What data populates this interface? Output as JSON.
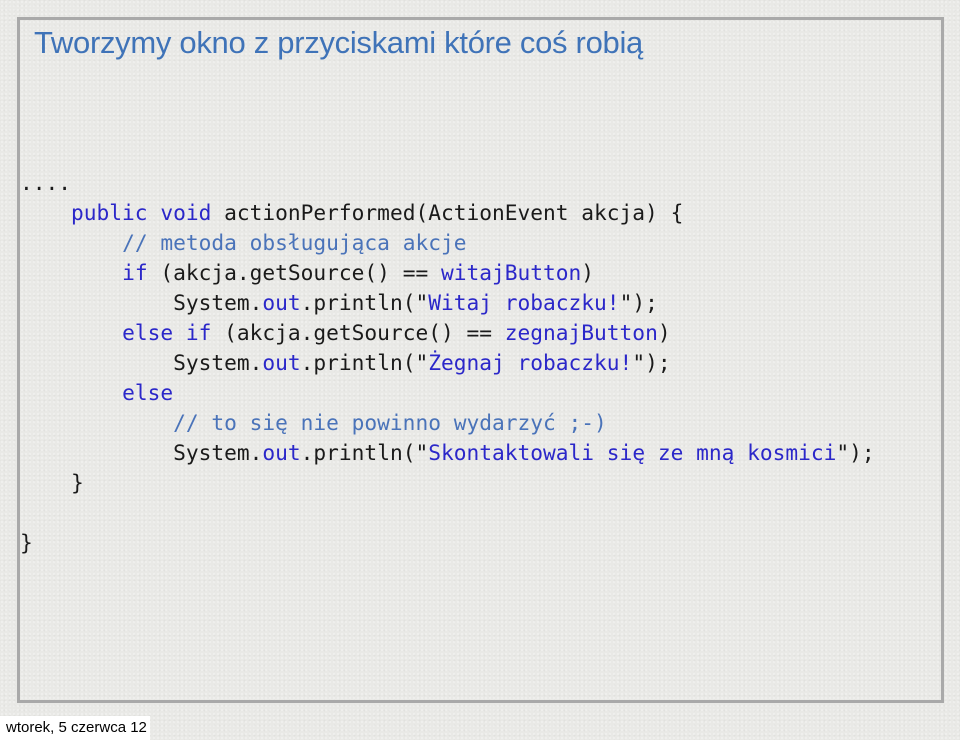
{
  "slide": {
    "title": "Tworzymy okno z przyciskami które coś robią",
    "title_color": "#3f73b8",
    "border_color": "#a9a9a9"
  },
  "code_colors": {
    "plain": "#1a1a1a",
    "keyword": "#2b27c9",
    "comment": "#4a73b9",
    "string": "#2b27c9"
  },
  "code_lines": [
    [
      {
        "t": "....",
        "k": "plain"
      }
    ],
    [
      {
        "t": "    ",
        "k": "plain"
      },
      {
        "t": "public void",
        "k": "keyword"
      },
      {
        "t": " actionPerformed(ActionEvent akcja) {",
        "k": "plain"
      }
    ],
    [
      {
        "t": "        ",
        "k": "plain"
      },
      {
        "t": "// metoda obsługująca akcje",
        "k": "comment"
      }
    ],
    [
      {
        "t": "        ",
        "k": "plain"
      },
      {
        "t": "if",
        "k": "keyword"
      },
      {
        "t": " (akcja.getSource() == ",
        "k": "plain"
      },
      {
        "t": "witajButton",
        "k": "keyword"
      },
      {
        "t": ")",
        "k": "plain"
      }
    ],
    [
      {
        "t": "            System.",
        "k": "plain"
      },
      {
        "t": "out",
        "k": "keyword"
      },
      {
        "t": ".println(\"",
        "k": "plain"
      },
      {
        "t": "Witaj robaczku!",
        "k": "string"
      },
      {
        "t": "\");",
        "k": "plain"
      }
    ],
    [
      {
        "t": "        ",
        "k": "plain"
      },
      {
        "t": "else if",
        "k": "keyword"
      },
      {
        "t": " (akcja.getSource() == ",
        "k": "plain"
      },
      {
        "t": "zegnajButton",
        "k": "keyword"
      },
      {
        "t": ")",
        "k": "plain"
      }
    ],
    [
      {
        "t": "            System.",
        "k": "plain"
      },
      {
        "t": "out",
        "k": "keyword"
      },
      {
        "t": ".println(\"",
        "k": "plain"
      },
      {
        "t": "Żegnaj robaczku!",
        "k": "string"
      },
      {
        "t": "\");",
        "k": "plain"
      }
    ],
    [
      {
        "t": "        ",
        "k": "plain"
      },
      {
        "t": "else",
        "k": "keyword"
      }
    ],
    [
      {
        "t": "            ",
        "k": "plain"
      },
      {
        "t": "// to się nie powinno wydarzyć ;-)",
        "k": "comment"
      }
    ],
    [
      {
        "t": "            System.",
        "k": "plain"
      },
      {
        "t": "out",
        "k": "keyword"
      },
      {
        "t": ".println(\"",
        "k": "plain"
      },
      {
        "t": "Skontaktowali się ze mną kosmici",
        "k": "string"
      },
      {
        "t": "\");",
        "k": "plain"
      }
    ],
    [
      {
        "t": "    }",
        "k": "plain"
      }
    ],
    [
      {
        "t": "",
        "k": "plain"
      }
    ],
    [
      {
        "t": "}",
        "k": "plain"
      }
    ]
  ],
  "footer": {
    "date": "wtorek, 5 czerwca 12"
  }
}
